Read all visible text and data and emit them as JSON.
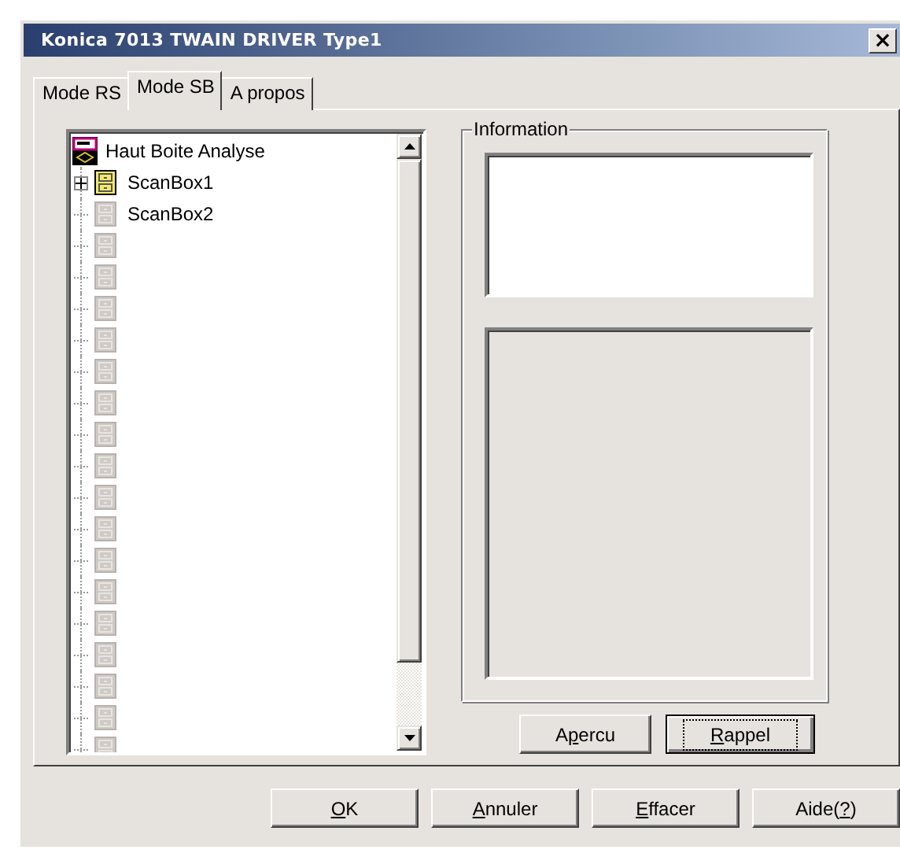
{
  "window": {
    "title": "Konica 7013 TWAIN DRIVER Type1",
    "close_label": "×"
  },
  "tabs": [
    {
      "label": "Mode RS",
      "selected": false
    },
    {
      "label": "Mode SB",
      "selected": true
    },
    {
      "label": "A propos",
      "selected": false
    }
  ],
  "tree": {
    "root": {
      "label": "Haut Boite Analyse"
    },
    "children": [
      {
        "label": "ScanBox1",
        "kind": "active",
        "expandable": true
      },
      {
        "label": "ScanBox2",
        "kind": "inactive",
        "expandable": false
      },
      {
        "kind": "inactive",
        "expandable": false
      },
      {
        "kind": "inactive",
        "expandable": false
      },
      {
        "kind": "inactive",
        "expandable": false
      },
      {
        "kind": "inactive",
        "expandable": false
      },
      {
        "kind": "inactive",
        "expandable": false
      },
      {
        "kind": "inactive",
        "expandable": false
      },
      {
        "kind": "inactive",
        "expandable": false
      },
      {
        "kind": "inactive",
        "expandable": false
      },
      {
        "kind": "inactive",
        "expandable": false
      },
      {
        "kind": "inactive",
        "expandable": false
      },
      {
        "kind": "inactive",
        "expandable": false
      },
      {
        "kind": "inactive",
        "expandable": false
      },
      {
        "kind": "inactive",
        "expandable": false
      },
      {
        "kind": "inactive",
        "expandable": false
      },
      {
        "kind": "inactive",
        "expandable": false
      },
      {
        "kind": "inactive",
        "expandable": false
      },
      {
        "kind": "inactive",
        "expandable": false
      }
    ]
  },
  "information": {
    "title": "Information"
  },
  "panel_buttons": [
    {
      "before": "A",
      "key": "p",
      "after": "ercu",
      "default": false
    },
    {
      "key": "R",
      "after": "appel",
      "default": true
    }
  ],
  "buttons": [
    {
      "key": "O",
      "after": "K",
      "default": false
    },
    {
      "key": "A",
      "after": "nnuler",
      "default": false
    },
    {
      "key": "E",
      "after": "ffacer",
      "default": false
    },
    {
      "before": "Aide(",
      "key": "?",
      "after": ")",
      "default": false
    }
  ]
}
